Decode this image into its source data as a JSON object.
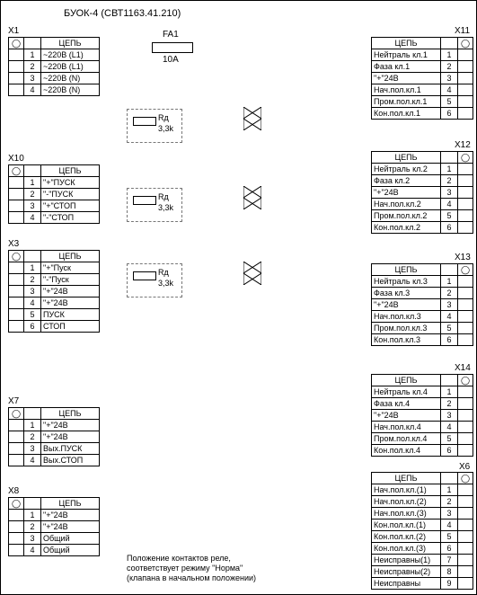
{
  "title": "БУОК-4 (СВТ1163.41.210)",
  "fuse": {
    "name": "FA1",
    "rating": "10A"
  },
  "resistors": [
    {
      "name": "Rд",
      "value": "3,3k"
    },
    {
      "name": "Rд",
      "value": "3,3k"
    },
    {
      "name": "Rд",
      "value": "3,3k"
    }
  ],
  "note_line1": "Положение контактов реле,",
  "note_line2": "соответствует режиму \"Норма\"",
  "note_line3": "(клапана в начальном положении)",
  "header_signal": "ЦЕПЬ",
  "left": {
    "X1": {
      "pins": [
        {
          "n": "1",
          "sig": "~220В (L1)"
        },
        {
          "n": "2",
          "sig": "~220В (L1)"
        },
        {
          "n": "3",
          "sig": "~220В (N)"
        },
        {
          "n": "4",
          "sig": "~220В (N)"
        }
      ]
    },
    "X10": {
      "pins": [
        {
          "n": "1",
          "sig": "\"+\"ПУСК"
        },
        {
          "n": "2",
          "sig": "\"-\"ПУСК"
        },
        {
          "n": "3",
          "sig": "\"+\"СТОП"
        },
        {
          "n": "4",
          "sig": "\"-\"СТОП"
        }
      ]
    },
    "X3": {
      "pins": [
        {
          "n": "1",
          "sig": "\"+\"Пуск"
        },
        {
          "n": "2",
          "sig": "\"-\"Пуск"
        },
        {
          "n": "3",
          "sig": "\"+\"24В"
        },
        {
          "n": "4",
          "sig": "\"+\"24В"
        },
        {
          "n": "5",
          "sig": "ПУСК"
        },
        {
          "n": "6",
          "sig": "СТОП"
        }
      ]
    },
    "X7": {
      "pins": [
        {
          "n": "1",
          "sig": "\"+\"24В"
        },
        {
          "n": "2",
          "sig": "\"+\"24В"
        },
        {
          "n": "3",
          "sig": "Вых.ПУСК"
        },
        {
          "n": "4",
          "sig": "Вых.СТОП"
        }
      ]
    },
    "X8": {
      "pins": [
        {
          "n": "1",
          "sig": "\"+\"24В"
        },
        {
          "n": "2",
          "sig": "\"+\"24В"
        },
        {
          "n": "3",
          "sig": "Общий"
        },
        {
          "n": "4",
          "sig": "Общий"
        }
      ]
    }
  },
  "right": {
    "X11": {
      "pins": [
        {
          "n": "1",
          "sig": "Нейтраль кл.1"
        },
        {
          "n": "2",
          "sig": "Фаза кл.1"
        },
        {
          "n": "3",
          "sig": "\"+\"24В"
        },
        {
          "n": "4",
          "sig": "Нач.пол.кл.1"
        },
        {
          "n": "5",
          "sig": "Пром.пол.кл.1"
        },
        {
          "n": "6",
          "sig": "Кон.пол.кл.1"
        }
      ]
    },
    "X12": {
      "pins": [
        {
          "n": "1",
          "sig": "Нейтраль кл.2"
        },
        {
          "n": "2",
          "sig": "Фаза кл.2"
        },
        {
          "n": "3",
          "sig": "\"+\"24В"
        },
        {
          "n": "4",
          "sig": "Нач.пол.кл.2"
        },
        {
          "n": "5",
          "sig": "Пром.пол.кл.2"
        },
        {
          "n": "6",
          "sig": "Кон.пол.кл.2"
        }
      ]
    },
    "X13": {
      "pins": [
        {
          "n": "1",
          "sig": "Нейтраль кл.3"
        },
        {
          "n": "2",
          "sig": "Фаза кл.3"
        },
        {
          "n": "3",
          "sig": "\"+\"24В"
        },
        {
          "n": "4",
          "sig": "Нач.пол.кл.3"
        },
        {
          "n": "5",
          "sig": "Пром.пол.кл.3"
        },
        {
          "n": "6",
          "sig": "Кон.пол.кл.3"
        }
      ]
    },
    "X14": {
      "pins": [
        {
          "n": "1",
          "sig": "Нейтраль кл.4"
        },
        {
          "n": "2",
          "sig": "Фаза кл.4"
        },
        {
          "n": "3",
          "sig": "\"+\"24В"
        },
        {
          "n": "4",
          "sig": "Нач.пол.кл.4"
        },
        {
          "n": "5",
          "sig": "Пром.пол.кл.4"
        },
        {
          "n": "6",
          "sig": "Кон.пол.кл.4"
        }
      ]
    },
    "X6": {
      "pins": [
        {
          "n": "1",
          "sig": "Нач.пол.кл.(1)"
        },
        {
          "n": "2",
          "sig": "Нач.пол.кл.(2)"
        },
        {
          "n": "3",
          "sig": "Нач.пол.кл.(3)"
        },
        {
          "n": "4",
          "sig": "Кон.пол.кл.(1)"
        },
        {
          "n": "5",
          "sig": "Кон.пол.кл.(2)"
        },
        {
          "n": "6",
          "sig": "Кон.пол.кл.(3)"
        },
        {
          "n": "7",
          "sig": "Неисправны(1)"
        },
        {
          "n": "8",
          "sig": "Неисправны(2)"
        },
        {
          "n": "9",
          "sig": "Неисправны"
        }
      ]
    }
  }
}
